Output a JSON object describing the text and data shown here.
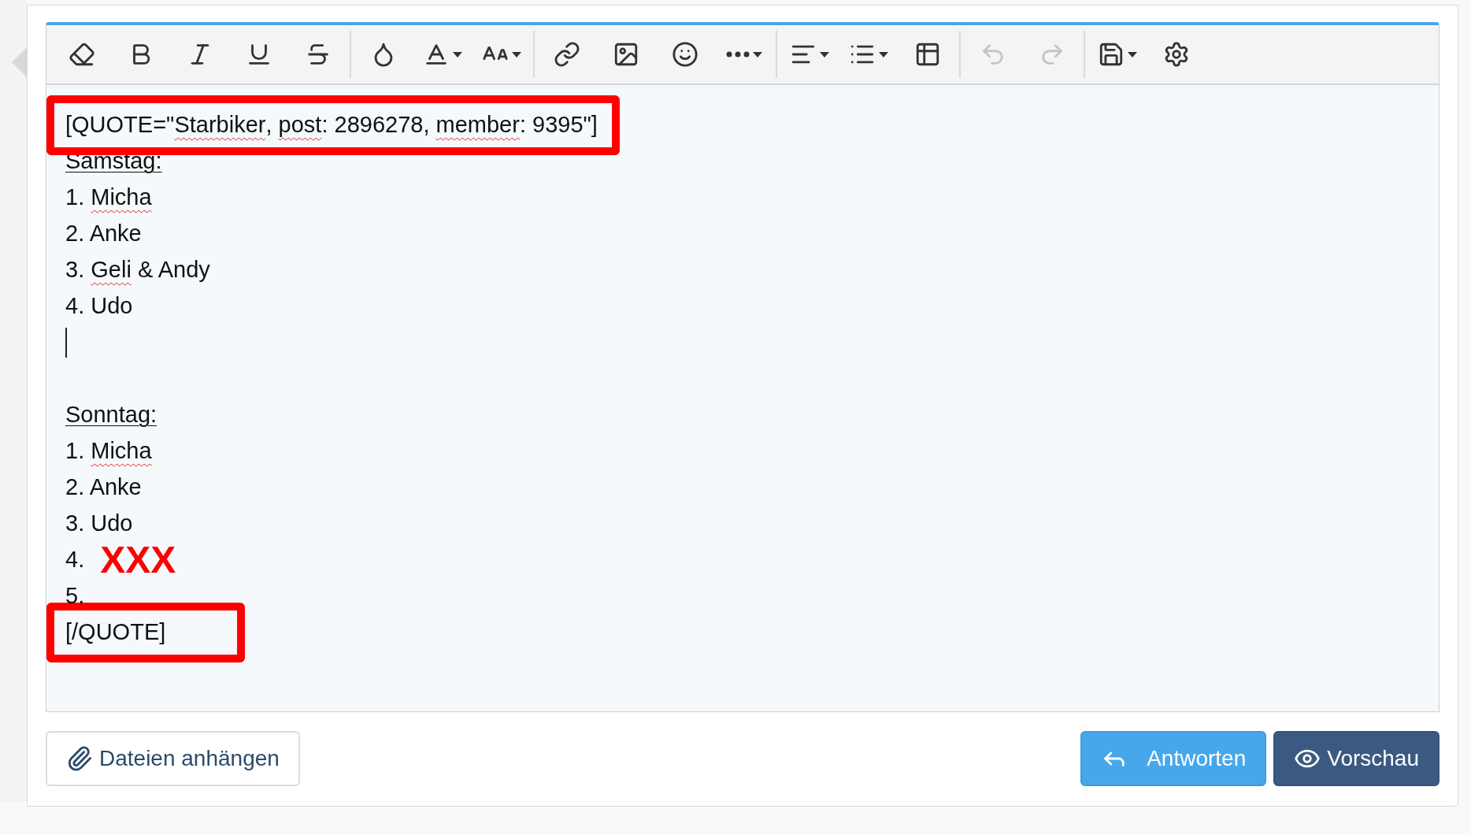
{
  "toolbar": {
    "groups": [
      [
        {
          "kind": "eraser",
          "menu": false,
          "disabled": false
        },
        {
          "kind": "bold",
          "menu": false,
          "disabled": false
        },
        {
          "kind": "italic",
          "menu": false,
          "disabled": false
        },
        {
          "kind": "underline",
          "menu": false,
          "disabled": false
        },
        {
          "kind": "strikethrough",
          "menu": false,
          "disabled": false
        }
      ],
      [
        {
          "kind": "droplet",
          "menu": false,
          "disabled": false
        },
        {
          "kind": "font-color",
          "menu": true,
          "disabled": false
        },
        {
          "kind": "text-size",
          "menu": true,
          "disabled": false
        }
      ],
      [
        {
          "kind": "link",
          "menu": false,
          "disabled": false
        },
        {
          "kind": "image",
          "menu": false,
          "disabled": false
        },
        {
          "kind": "smiley",
          "menu": false,
          "disabled": false
        },
        {
          "kind": "more",
          "menu": true,
          "disabled": false
        }
      ],
      [
        {
          "kind": "align",
          "menu": true,
          "disabled": false
        },
        {
          "kind": "list",
          "menu": true,
          "disabled": false
        },
        {
          "kind": "table",
          "menu": false,
          "disabled": false
        }
      ],
      [
        {
          "kind": "undo",
          "menu": false,
          "disabled": true
        },
        {
          "kind": "redo",
          "menu": false,
          "disabled": true
        }
      ],
      [
        {
          "kind": "save",
          "menu": true,
          "disabled": false
        },
        {
          "kind": "settings",
          "menu": false,
          "disabled": false
        }
      ]
    ]
  },
  "editor": {
    "lines": [
      {
        "kind": "text",
        "highlighted": true,
        "segments": [
          {
            "text": "[QUOTE=\"",
            "misspelled": false
          },
          {
            "text": "Starbiker",
            "misspelled": true
          },
          {
            "text": ", ",
            "misspelled": false
          },
          {
            "text": "post",
            "misspelled": true
          },
          {
            "text": ": 2896278, ",
            "misspelled": false
          },
          {
            "text": "member",
            "misspelled": true
          },
          {
            "text": ": 9395\"]",
            "misspelled": false
          }
        ]
      },
      {
        "kind": "heading",
        "text": "Samstag:"
      },
      {
        "kind": "text",
        "highlighted": false,
        "segments": [
          {
            "text": "1. ",
            "misspelled": false
          },
          {
            "text": "Micha",
            "misspelled": true
          }
        ]
      },
      {
        "kind": "text",
        "highlighted": false,
        "segments": [
          {
            "text": "2. Anke",
            "misspelled": false
          }
        ]
      },
      {
        "kind": "text",
        "highlighted": false,
        "segments": [
          {
            "text": "3. ",
            "misspelled": false
          },
          {
            "text": "Geli",
            "misspelled": true
          },
          {
            "text": " & Andy",
            "misspelled": false
          }
        ]
      },
      {
        "kind": "text",
        "highlighted": false,
        "segments": [
          {
            "text": "4. Udo",
            "misspelled": false
          }
        ]
      },
      {
        "kind": "cursor"
      },
      {
        "kind": "blank"
      },
      {
        "kind": "heading",
        "text": "Sonntag:"
      },
      {
        "kind": "text",
        "highlighted": false,
        "segments": [
          {
            "text": "1. ",
            "misspelled": false
          },
          {
            "text": "Micha",
            "misspelled": true
          }
        ]
      },
      {
        "kind": "text",
        "highlighted": false,
        "segments": [
          {
            "text": "2. Anke",
            "misspelled": false
          }
        ]
      },
      {
        "kind": "text",
        "highlighted": false,
        "segments": [
          {
            "text": "3. Udo",
            "misspelled": false
          }
        ]
      },
      {
        "kind": "marked",
        "label": "4.",
        "mark": "XXX",
        "color": "#ff0000"
      },
      {
        "kind": "text",
        "highlighted": false,
        "segments": [
          {
            "text": "5.",
            "misspelled": false
          }
        ]
      },
      {
        "kind": "text",
        "highlighted": true,
        "segments": [
          {
            "text": "[/QUOTE]",
            "misspelled": false
          }
        ]
      }
    ]
  },
  "buttons": [
    {
      "kind": "attach",
      "label": "Dateien anhängen"
    },
    {
      "kind": "reply",
      "label": "Antworten"
    },
    {
      "kind": "preview",
      "label": "Vorschau"
    }
  ]
}
